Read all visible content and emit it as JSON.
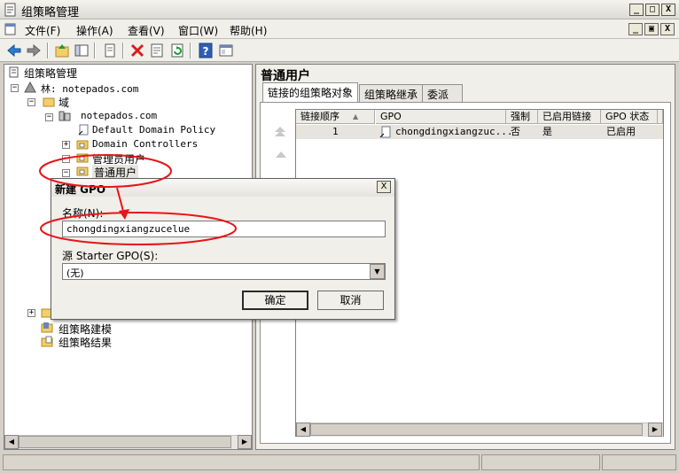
{
  "window": {
    "title": "组策略管理",
    "controls": {
      "minimize": "_",
      "maximize": "□",
      "close": "X"
    },
    "mdi_controls": {
      "minimize": "_",
      "restore": "▣",
      "close": "X"
    }
  },
  "menu": [
    "文件(F)",
    "操作(A)",
    "查看(V)",
    "窗口(W)",
    "帮助(H)"
  ],
  "toolbar": [
    "back-icon",
    "forward-icon",
    "up-folder-icon",
    "show-hide-tree-icon",
    "copy-icon",
    "delete-icon",
    "properties-icon",
    "refresh-icon",
    "help-icon",
    "export-icon"
  ],
  "tree": {
    "root": "组策略管理",
    "forest": "林: notepados.com",
    "domains": "域",
    "domain": "notepados.com",
    "default_policy": "Default Domain Policy",
    "domain_controllers": "Domain Controllers",
    "admin_ou": "管理员用户",
    "users_ou": "普通用户",
    "modeling": "组策略建模",
    "results": "组策略结果"
  },
  "right": {
    "title": "普通用户",
    "tabs": [
      "链接的组策略对象",
      "组策略继承",
      "委派"
    ],
    "columns": [
      "链接顺序",
      "GPO",
      "强制",
      "已启用链接",
      "GPO 状态"
    ],
    "sort_indicator": "▲",
    "rows": [
      {
        "order": "1",
        "gpo": "chongdingxiangzuc...",
        "enforced": "否",
        "link_enabled": "是",
        "status": "已启用"
      }
    ]
  },
  "dialog": {
    "title": "新建 GPO",
    "name_label": "名称(N):",
    "name_value": "chongdingxiangzucelue",
    "source_label": "源 Starter GPO(S):",
    "source_value": "(无)",
    "ok": "确定",
    "cancel": "取消",
    "close": "X"
  },
  "colors": {
    "annotation": "#e8141a",
    "selection": "#e6e4de"
  }
}
